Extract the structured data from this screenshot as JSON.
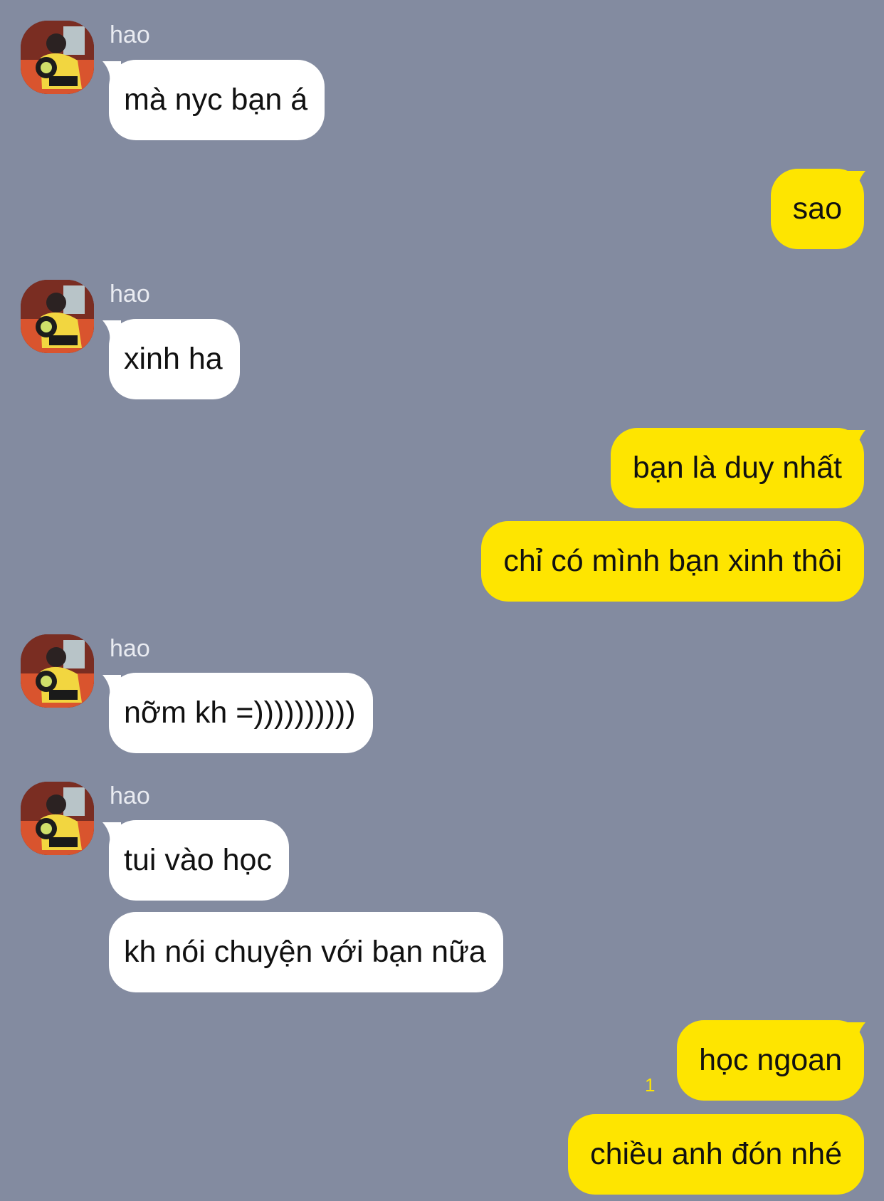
{
  "colors": {
    "background": "#838BA0",
    "incoming_bubble": "#FFFFFF",
    "outgoing_bubble": "#FEE500",
    "sender_name": "#E9EBF1",
    "unread_count": "#FEE500"
  },
  "contact": {
    "name": "hao",
    "avatar_icon": "profile-photo-avatar"
  },
  "messages": [
    {
      "from": "contact",
      "sender": "hao",
      "text": "mà nyc bạn á"
    },
    {
      "from": "me",
      "text": "sao"
    },
    {
      "from": "contact",
      "sender": "hao",
      "text": "xinh ha"
    },
    {
      "from": "me",
      "text": "bạn là duy nhất"
    },
    {
      "from": "me",
      "text": "chỉ có mình bạn xinh thôi"
    },
    {
      "from": "contact",
      "sender": "hao",
      "text": "nỡm kh =))))))))))"
    },
    {
      "from": "contact",
      "sender": "hao",
      "text": "tui vào học"
    },
    {
      "from": "contact",
      "text": "kh nói chuyện với bạn nữa"
    },
    {
      "from": "me",
      "text": "học ngoan",
      "unread_count": "1"
    },
    {
      "from": "me",
      "text": "chiều anh đón nhé"
    }
  ]
}
